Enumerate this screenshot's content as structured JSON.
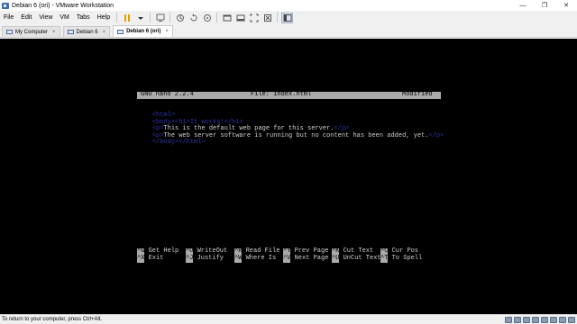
{
  "window": {
    "title": "Debian 6 (ori) - VMware Workstation",
    "controls": {
      "minimize": "—",
      "restore": "❐",
      "close": "✕"
    }
  },
  "menu": [
    "File",
    "Edit",
    "View",
    "VM",
    "Tabs",
    "Help"
  ],
  "tabs": [
    {
      "label": "My Computer",
      "close": "×",
      "active": false
    },
    {
      "label": "Debian 6",
      "close": "×",
      "active": false
    },
    {
      "label": "Debian 6 (ori)",
      "close": "×",
      "active": true
    }
  ],
  "nano": {
    "header": {
      "version": "GNU nano 2.2.4",
      "file": "File: index.html",
      "status": "Modified"
    },
    "lines": [
      {
        "tag": "<html>",
        "text": ""
      },
      {
        "tag": "<body><h1>It works!</h1>",
        "text": ""
      },
      {
        "tag": "<p>",
        "text": "This is the default web page for this server.",
        "tag2": "</p>"
      },
      {
        "tag": "<p>",
        "text": "The web server software is running but no content has been added, yet.",
        "tag2": "</p>"
      },
      {
        "tag": "</body></html>",
        "text": ""
      }
    ],
    "shortcuts_row1": [
      {
        "key": "^G",
        "label": " Get Help"
      },
      {
        "key": "^O",
        "label": " WriteOut"
      },
      {
        "key": "^R",
        "label": " Read File"
      },
      {
        "key": "^Y",
        "label": " Prev Page"
      },
      {
        "key": "^K",
        "label": " Cut Text"
      },
      {
        "key": "^C",
        "label": " Cur Pos"
      }
    ],
    "shortcuts_row2": [
      {
        "key": "^X",
        "label": " Exit"
      },
      {
        "key": "^J",
        "label": " Justify"
      },
      {
        "key": "^W",
        "label": " Where Is"
      },
      {
        "key": "^V",
        "label": " Next Page"
      },
      {
        "key": "^U",
        "label": " UnCut Text"
      },
      {
        "key": "^T",
        "label": " To Spell"
      }
    ]
  },
  "status": {
    "text": "To return to your computer, press Ctrl+Alt."
  },
  "colors": {
    "console_bg": "#000000",
    "tag_color": "#2a35a8",
    "header_bg": "#aaaaaa"
  }
}
